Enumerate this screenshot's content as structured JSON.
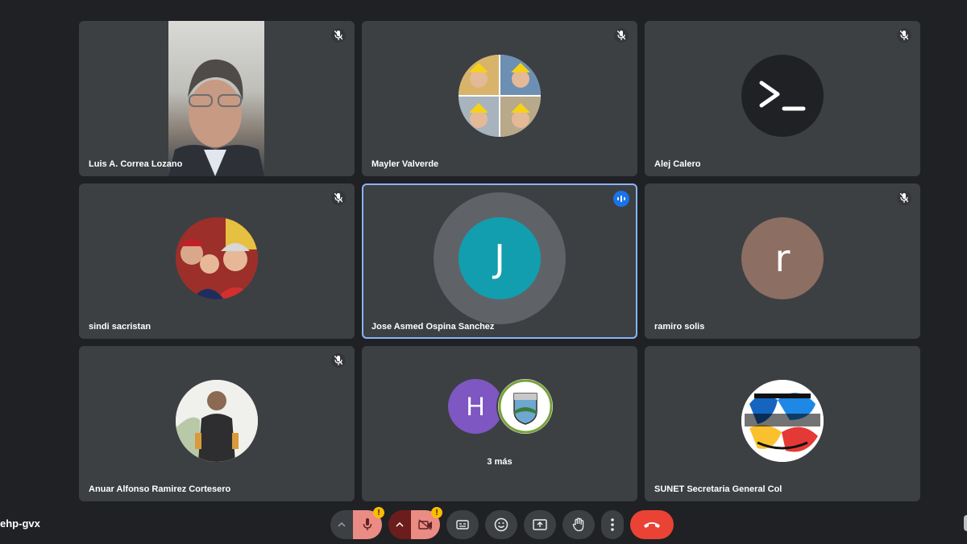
{
  "meeting": {
    "code": "ehp-gvx"
  },
  "participants": [
    {
      "name": "Luis A. Correa Lozano",
      "muted": true,
      "kind": "video"
    },
    {
      "name": "Mayler Valverde",
      "muted": true,
      "kind": "photo-avatar"
    },
    {
      "name": "Alej Calero",
      "muted": true,
      "kind": "icon-avatar"
    },
    {
      "name": "sindi sacristan",
      "muted": true,
      "kind": "photo-avatar"
    },
    {
      "name": "Jose Asmed Ospina Sanchez",
      "muted": false,
      "speaking": true,
      "kind": "letter-avatar",
      "letter": "J",
      "color": "#129eaf"
    },
    {
      "name": "ramiro solis",
      "muted": true,
      "kind": "letter-avatar",
      "letter": "r",
      "color": "#8d6e63"
    },
    {
      "name": "Anuar Alfonso Ramirez Cortesero",
      "muted": true,
      "kind": "photo-avatar"
    },
    {
      "name": "SUNET Secretaria General Col",
      "muted": false,
      "kind": "photo-avatar"
    }
  ],
  "overflow": {
    "letter": "H",
    "color": "#7e57c2",
    "label": "3 más"
  },
  "controls": {
    "mic": {
      "icon": "mic-icon",
      "warning": "!"
    },
    "camera": {
      "icon": "camera-off-icon",
      "warning": "!"
    },
    "captions": {
      "icon": "captions-icon"
    },
    "emoji": {
      "icon": "emoji-icon"
    },
    "present": {
      "icon": "present-screen-icon"
    },
    "hand": {
      "icon": "raise-hand-icon"
    },
    "more": {
      "icon": "more-options-icon"
    },
    "hangup": {
      "icon": "hang-up-icon",
      "color": "#ea4335"
    }
  },
  "colors": {
    "background": "#202124",
    "tile": "#3c4043",
    "active_border": "#8ab4f8"
  }
}
